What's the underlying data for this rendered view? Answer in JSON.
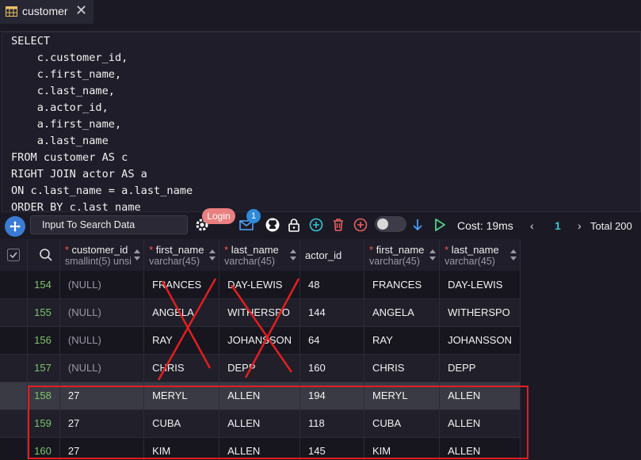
{
  "tab": {
    "icon": "table-icon",
    "title": "customer",
    "close": "✕"
  },
  "sql": [
    "SELECT",
    "    c.customer_id,",
    "    c.first_name,",
    "    c.last_name,",
    "    a.actor_id,",
    "    a.first_name,",
    "    a.last_name",
    "FROM customer AS c",
    "RIGHT JOIN actor AS a",
    "ON c.last_name = a.last_name",
    "ORDER BY c.last_name"
  ],
  "toolbar": {
    "search_placeholder": "Input To Search Data",
    "login_label": "Login",
    "mail_badge": "1",
    "cost_label": "Cost: 19ms",
    "page_number": "1",
    "total_label": "Total 200",
    "toggle_on": false
  },
  "columns": [
    {
      "name": "customer_id",
      "type": "smallint(5) unsi",
      "required": true
    },
    {
      "name": "first_name",
      "type": "varchar(45)",
      "required": true
    },
    {
      "name": "last_name",
      "type": "varchar(45)",
      "required": true
    },
    {
      "name": "actor_id",
      "type": "",
      "required": false
    },
    {
      "name": "first_name",
      "type": "varchar(45)",
      "required": true
    },
    {
      "name": "last_name",
      "type": "varchar(45)",
      "required": true
    }
  ],
  "rows": [
    {
      "n": "154",
      "cells": [
        "(NULL)",
        "FRANCES",
        "DAY-LEWIS",
        "48",
        "FRANCES",
        "DAY-LEWIS"
      ]
    },
    {
      "n": "155",
      "cells": [
        "(NULL)",
        "ANGELA",
        "WITHERSPO",
        "144",
        "ANGELA",
        "WITHERSPO"
      ]
    },
    {
      "n": "156",
      "cells": [
        "(NULL)",
        "RAY",
        "JOHANSSON",
        "64",
        "RAY",
        "JOHANSSON"
      ]
    },
    {
      "n": "157",
      "cells": [
        "(NULL)",
        "CHRIS",
        "DEPP",
        "160",
        "CHRIS",
        "DEPP"
      ]
    },
    {
      "n": "158",
      "cells": [
        "27",
        "MERYL",
        "ALLEN",
        "194",
        "MERYL",
        "ALLEN"
      ]
    },
    {
      "n": "159",
      "cells": [
        "27",
        "CUBA",
        "ALLEN",
        "118",
        "CUBA",
        "ALLEN"
      ]
    },
    {
      "n": "160",
      "cells": [
        "27",
        "KIM",
        "ALLEN",
        "145",
        "KIM",
        "ALLEN"
      ]
    }
  ],
  "colors": {
    "accent": "#3a7bd5",
    "row_number": "#7dc46c",
    "annotation_red": "#e11f1f"
  }
}
